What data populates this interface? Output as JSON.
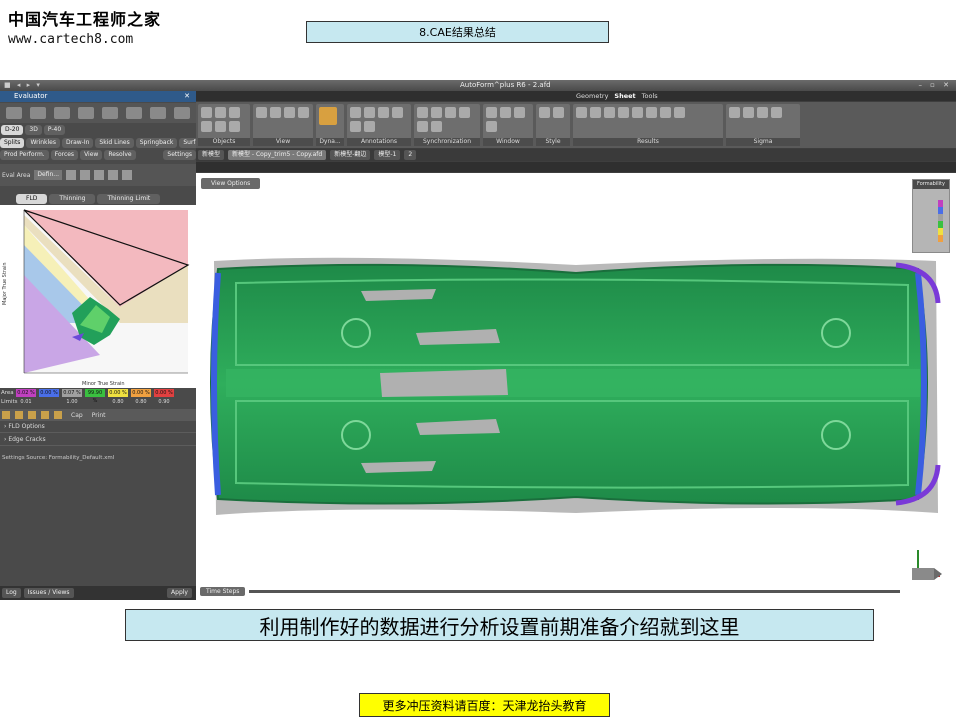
{
  "logo": {
    "cn": "中国汽车工程师之家",
    "url": "www.cartech8.com"
  },
  "slide_title": "8.CAE结果总结",
  "app": {
    "window_title": "AutoForm^plus R6 - 2.afd",
    "panel_title": "Evaluator",
    "left_tabs_row1": [
      "D-20",
      "3D",
      "P-40"
    ],
    "left_tabs_row2": [
      "Splits",
      "Wrinkles",
      "Draw-In",
      "Skid Lines",
      "Springback",
      "Surface"
    ],
    "left_tabs_row3": [
      "Prod Perform.",
      "Forces",
      "View",
      "Resolve",
      "Settings"
    ],
    "eval_area_label": "Eval Area",
    "eval_area_value": "Defin...",
    "fld_tabs": [
      "FLD",
      "Thinning",
      "Thinning Limit"
    ],
    "stats_area_label": "Area",
    "stats_limits_label": "Limits",
    "stats_cells": [
      {
        "value": "0.02 %",
        "color": "#c040c0"
      },
      {
        "value": "0.00 %",
        "color": "#4a6ee8"
      },
      {
        "value": "0.07 %",
        "color": "#a0a0a0"
      },
      {
        "value": "99.90 %",
        "color": "#3ac040"
      },
      {
        "value": "0.00 %",
        "color": "#f0e040"
      },
      {
        "value": "0.00 %",
        "color": "#f0a040"
      },
      {
        "value": "0.00 %",
        "color": "#e04040"
      }
    ],
    "stats_limits": [
      "0.01",
      "",
      "1.00",
      "",
      "0.80",
      "0.80",
      "0.90"
    ],
    "opt_toolbar_texts": [
      "Cap",
      "Print"
    ],
    "fld_options": "FLD Options",
    "edge_cracks": "Edge Cracks",
    "settings_source": "Settings Source:  Formability_Default.xml",
    "bottom_buttons": [
      "Log",
      "Issues / Views",
      "Apply"
    ],
    "ribbon_tabs": [
      "Geometry",
      "Sheet",
      "Tools"
    ],
    "ribbon_active_tab": "Sheet",
    "ribbon_groups": [
      "Objects",
      "View",
      "Dyna...",
      "Annotations",
      "Synchronization",
      "Window",
      "Style",
      "Results",
      "Sigma"
    ],
    "doc_tabs": [
      "新模型",
      "新模型 - Copy_trim5 - Copy.afd",
      "新模型-翻边",
      "模型-1",
      "2"
    ],
    "view_options": "View Options",
    "legend_title": "Formability",
    "legend_colors": [
      "#c040c0",
      "#4a6ee8",
      "#a0a0a0",
      "#3ac040",
      "#f0e040",
      "#f0a040"
    ],
    "time_steps": "Time Steps"
  },
  "caption": "利用制作好的数据进行分析设置前期准备介绍就到这里",
  "footer": "更多冲压资料请百度：天津龙抬头教育"
}
